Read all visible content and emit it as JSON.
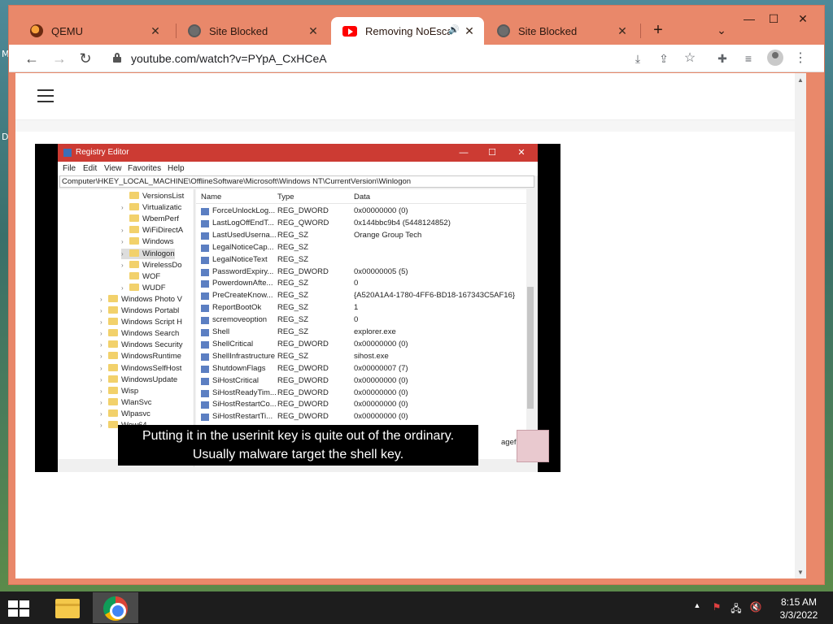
{
  "desktop": {
    "labels": [
      "M",
      "D"
    ]
  },
  "tabs": [
    {
      "label": "QEMU",
      "icon": "qemu-icon"
    },
    {
      "label": "Site Blocked",
      "icon": "globe-icon"
    },
    {
      "label": "Removing NoEscape",
      "icon": "youtube-icon",
      "active": true,
      "audio": "🔊"
    },
    {
      "label": "Site Blocked",
      "icon": "globe-icon"
    }
  ],
  "tabstrip": {
    "new_tab": "+",
    "tab_search": "⌄",
    "close": "✕"
  },
  "window_controls": {
    "minimize": "—",
    "maximize": "☐",
    "close": "✕"
  },
  "toolbar": {
    "back": "←",
    "forward": "→",
    "reload": "↻",
    "url": "youtube.com/watch?v=PYpA_CxHCeA",
    "icons": {
      "download": "⤓",
      "share": "⇪",
      "bookmark": "☆",
      "extensions": "✚",
      "media": "≡",
      "menu": "⋮"
    }
  },
  "scroll": {
    "up": "▲",
    "down": "▼"
  },
  "video": {
    "app_title": "Registry Editor",
    "window_buttons": {
      "minimize": "—",
      "maximize": "☐",
      "close": "✕"
    },
    "menu": [
      "File",
      "Edit",
      "View",
      "Favorites",
      "Help"
    ],
    "address": "Computer\\HKEY_LOCAL_MACHINE\\OfflineSoftware\\Microsoft\\Windows NT\\CurrentVersion\\Winlogon",
    "tree": [
      {
        "label": "VersionsList",
        "indent": 2,
        "chev": ""
      },
      {
        "label": "Virtualizatic",
        "indent": 2,
        "chev": "›"
      },
      {
        "label": "WbemPerf",
        "indent": 2,
        "chev": ""
      },
      {
        "label": "WiFiDirectA",
        "indent": 2,
        "chev": "›"
      },
      {
        "label": "Windows",
        "indent": 2,
        "chev": "›"
      },
      {
        "label": "Winlogon",
        "indent": 2,
        "chev": "›",
        "selected": true
      },
      {
        "label": "WirelessDo",
        "indent": 2,
        "chev": "›"
      },
      {
        "label": "WOF",
        "indent": 2,
        "chev": ""
      },
      {
        "label": "WUDF",
        "indent": 2,
        "chev": "›"
      },
      {
        "label": "Windows Photo V",
        "indent": 1,
        "chev": "›"
      },
      {
        "label": "Windows Portabl",
        "indent": 1,
        "chev": "›"
      },
      {
        "label": "Windows Script H",
        "indent": 1,
        "chev": "›"
      },
      {
        "label": "Windows Search",
        "indent": 1,
        "chev": "›"
      },
      {
        "label": "Windows Security",
        "indent": 1,
        "chev": "›"
      },
      {
        "label": "WindowsRuntime",
        "indent": 1,
        "chev": "›"
      },
      {
        "label": "WindowsSelfHost",
        "indent": 1,
        "chev": "›"
      },
      {
        "label": "WindowsUpdate",
        "indent": 1,
        "chev": "›"
      },
      {
        "label": "Wisp",
        "indent": 1,
        "chev": "›"
      },
      {
        "label": "WlanSvc",
        "indent": 1,
        "chev": "›"
      },
      {
        "label": "Wlpasvc",
        "indent": 1,
        "chev": "›"
      },
      {
        "label": "Wow64",
        "indent": 1,
        "chev": "›"
      }
    ],
    "columns": {
      "name": "Name",
      "type": "Type",
      "data": "Data"
    },
    "rows": [
      {
        "name": "ForceUnlockLog...",
        "type": "REG_DWORD",
        "data": "0x00000000 (0)"
      },
      {
        "name": "LastLogOffEndT...",
        "type": "REG_QWORD",
        "data": "0x144bbc9b4 (5448124852)"
      },
      {
        "name": "LastUsedUserna...",
        "type": "REG_SZ",
        "data": "Orange Group Tech"
      },
      {
        "name": "LegalNoticeCap...",
        "type": "REG_SZ",
        "data": ""
      },
      {
        "name": "LegalNoticeText",
        "type": "REG_SZ",
        "data": ""
      },
      {
        "name": "PasswordExpiry...",
        "type": "REG_DWORD",
        "data": "0x00000005 (5)"
      },
      {
        "name": "PowerdownAfte...",
        "type": "REG_SZ",
        "data": "0"
      },
      {
        "name": "PreCreateKnow...",
        "type": "REG_SZ",
        "data": "{A520A1A4-1780-4FF6-BD18-167343C5AF16}"
      },
      {
        "name": "ReportBootOk",
        "type": "REG_SZ",
        "data": "1"
      },
      {
        "name": "scremoveoption",
        "type": "REG_SZ",
        "data": "0"
      },
      {
        "name": "Shell",
        "type": "REG_SZ",
        "data": "explorer.exe"
      },
      {
        "name": "ShellCritical",
        "type": "REG_DWORD",
        "data": "0x00000000 (0)"
      },
      {
        "name": "ShellInfrastructure",
        "type": "REG_SZ",
        "data": "sihost.exe"
      },
      {
        "name": "ShutdownFlags",
        "type": "REG_DWORD",
        "data": "0x00000007 (7)"
      },
      {
        "name": "SiHostCritical",
        "type": "REG_DWORD",
        "data": "0x00000000 (0)"
      },
      {
        "name": "SiHostReadyTim...",
        "type": "REG_DWORD",
        "data": "0x00000000 (0)"
      },
      {
        "name": "SiHostRestartCo...",
        "type": "REG_DWORD",
        "data": "0x00000000 (0)"
      },
      {
        "name": "SiHostRestartTi...",
        "type": "REG_DWORD",
        "data": "0x00000000 (0)"
      }
    ],
    "partial_row_text": "agefile",
    "subtitle_line1": "Putting it in the userinit key is quite out of the ordinary.",
    "subtitle_line2": "Usually malware target the shell key."
  },
  "taskbar": {
    "apps": [
      {
        "name": "file-explorer",
        "active": false
      },
      {
        "name": "chrome",
        "active": true
      }
    ],
    "tray": {
      "show_hidden": "▲",
      "flag": "⚑",
      "network": "🖧",
      "volume": "🔇"
    },
    "time": "8:15 AM",
    "date": "3/3/2022"
  },
  "colors": {
    "tab_strip": "#e9886a",
    "registry_title": "#cc3b33",
    "taskbar": "#1d1d1d"
  }
}
